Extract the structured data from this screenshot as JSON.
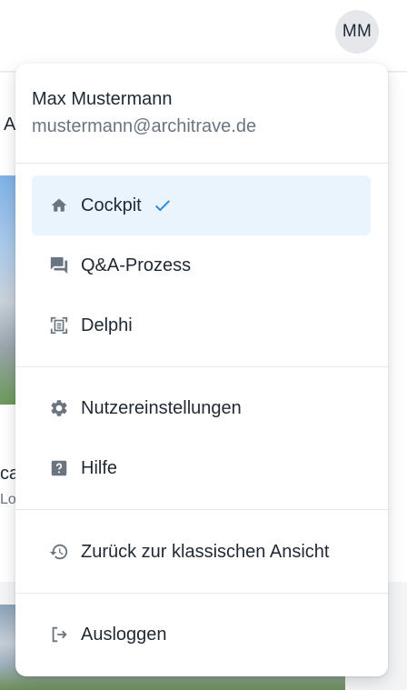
{
  "header": {
    "avatar_initials": "MM"
  },
  "background": {
    "fragment_a": "A",
    "fragment_ca": "ca",
    "fragment_lo": "Lo"
  },
  "user": {
    "name": "Max Mustermann",
    "email": "mustermann@architrave.de"
  },
  "menu": {
    "main_items": [
      {
        "label": "Cockpit",
        "icon": "home-icon",
        "active": true
      },
      {
        "label": "Q&A-Prozess",
        "icon": "chat-bubbles-icon",
        "active": false
      },
      {
        "label": "Delphi",
        "icon": "document-scan-icon",
        "active": false
      }
    ],
    "settings_items": [
      {
        "label": "Nutzereinstellungen",
        "icon": "gear-icon"
      },
      {
        "label": "Hilfe",
        "icon": "help-icon"
      }
    ],
    "classic_view": {
      "label": "Zurück zur klassischen Ansicht",
      "icon": "history-icon"
    },
    "logout": {
      "label": "Ausloggen",
      "icon": "logout-icon"
    }
  },
  "colors": {
    "accent": "#1e88e5",
    "active_bg": "#eaf4fd",
    "icon": "#6b7580"
  }
}
